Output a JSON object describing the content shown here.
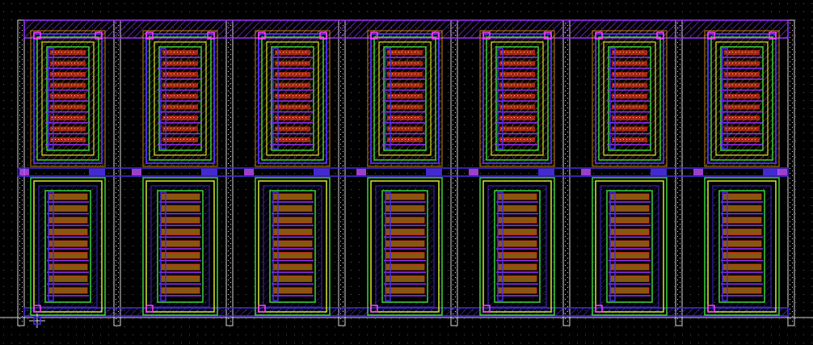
{
  "canvas": {
    "background": "#000000",
    "grid_dot_color": "#5a5a5a"
  },
  "layers": {
    "metal1": "#4b2ee6",
    "metal2": "#9a33ff",
    "poly": "#e8331f",
    "diffusion": "#3ad53a",
    "nwell": "#d9e82e",
    "implant": "#f0a01a",
    "contact": "#c44dff",
    "via": "#ff40ff",
    "boundary": "#d9d9d9"
  },
  "array": {
    "columns": 7,
    "rows": 2,
    "fingers_per_device": 9
  },
  "icons": {
    "origin_marker": "origin-crosshair-icon"
  }
}
